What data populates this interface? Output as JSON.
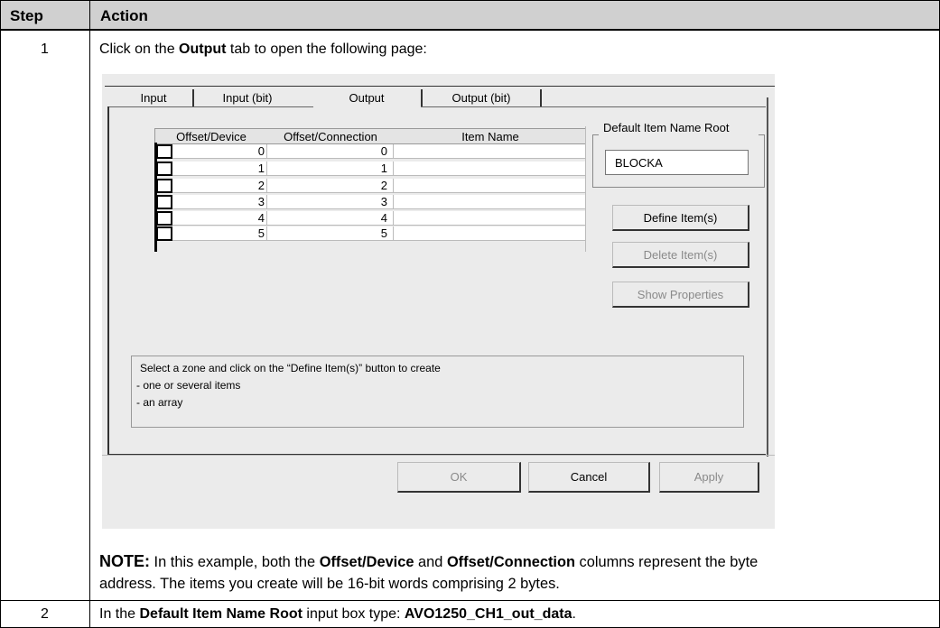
{
  "table": {
    "header": {
      "step": "Step",
      "action": "Action"
    },
    "rows": [
      {
        "step": "1",
        "instruction": {
          "pre": "Click on the ",
          "bold": "Output",
          "post": " tab to open the following page:"
        },
        "note": {
          "label": "NOTE:",
          "t1": " In this example, both the ",
          "b1": "Offset/Device",
          "t2": " and ",
          "b2": "Offset/Connection",
          "t3": " columns represent the byte",
          "line2": "address. The items you create will be 16-bit words comprising 2 bytes."
        }
      },
      {
        "step": "2",
        "instruction": {
          "pre": "In the ",
          "bold": "Default Item Name Root",
          "mid": " input box type: ",
          "bold2": "AVO1250_CH1_out_data",
          "post": "."
        }
      }
    ]
  },
  "dialog": {
    "tabs": [
      "Input",
      "Input (bit)",
      "Output",
      "Output (bit)"
    ],
    "active_tab": "Output",
    "grid": {
      "columns": [
        "Offset/Device",
        "Offset/Connection",
        "Item Name"
      ],
      "rows": [
        {
          "device": "0",
          "connection": "0",
          "item_name": ""
        },
        {
          "device": "1",
          "connection": "1",
          "item_name": ""
        },
        {
          "device": "2",
          "connection": "2",
          "item_name": ""
        },
        {
          "device": "3",
          "connection": "3",
          "item_name": ""
        },
        {
          "device": "4",
          "connection": "4",
          "item_name": ""
        },
        {
          "device": "5",
          "connection": "5",
          "item_name": ""
        }
      ]
    },
    "default_root": {
      "label": "Default Item Name Root",
      "value": "BLOCKA"
    },
    "buttons": {
      "define": "Define Item(s)",
      "delete": "Delete Item(s)",
      "properties": "Show Properties",
      "ok": "OK",
      "cancel": "Cancel",
      "apply": "Apply"
    },
    "info": [
      "Select a zone and click on the “Define Item(s)” button to create",
      "- one or several items",
      "- an array"
    ]
  }
}
